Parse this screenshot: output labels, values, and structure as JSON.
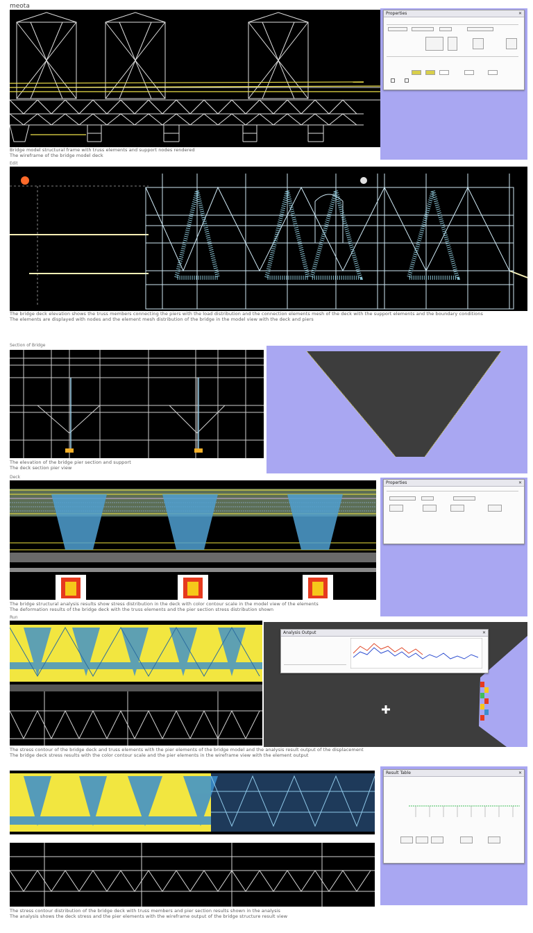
{
  "header": {
    "title": "meota"
  },
  "panels": [
    {
      "label": "",
      "caption_lines": [
        "Bridge model structural frame with truss elements and support nodes rendered",
        "The wireframe of the bridge model deck"
      ]
    },
    {
      "label": "Edit",
      "caption_lines": [
        "The bridge deck elevation shows the truss members connecting the piers with the load distribution and the connection elements mesh of the deck with the support elements and the boundary conditions",
        "The elements are displayed with nodes and the element mesh distribution of the bridge in the model view with the deck and piers"
      ]
    },
    {
      "label": "Section of Bridge",
      "caption_lines": [
        "The elevation of the bridge pier section and support",
        "The deck section pier view"
      ]
    },
    {
      "label": "Deck",
      "caption_lines": [
        "The bridge structural analysis results show stress distribution in the deck with color contour scale in the model view of the elements",
        "The deformation results of the bridge deck with the truss elements and the pier section stress distribution shown"
      ]
    },
    {
      "label": "Run",
      "caption_lines": [
        "The stress contour of the bridge deck and truss elements with the pier elements of the bridge model and the analysis result output of the displacement",
        "The bridge deck stress results with the color contour scale and the pier elements in the wireframe view with the element output"
      ]
    },
    {
      "label": "",
      "caption_lines": [
        "The stress contour distribution of the bridge deck with truss members and pier section results shown in the analysis",
        "The analysis shows the deck stress and the pier elements with the wireframe output of the bridge structure result view"
      ]
    }
  ],
  "dialogs": {
    "d1": {
      "title": "Properties"
    },
    "d2": {
      "title": "Properties"
    },
    "d3": {
      "title": "Analysis Output"
    },
    "d4": {
      "title": "Result Table"
    }
  },
  "colors": {
    "lavender": "#a9a7f2",
    "viewport": "#000000",
    "dark_canvas": "#3d3d3d",
    "wire": "#d8d8d8",
    "cyan": "#7fd0e0",
    "yellow": "#f2e640"
  }
}
